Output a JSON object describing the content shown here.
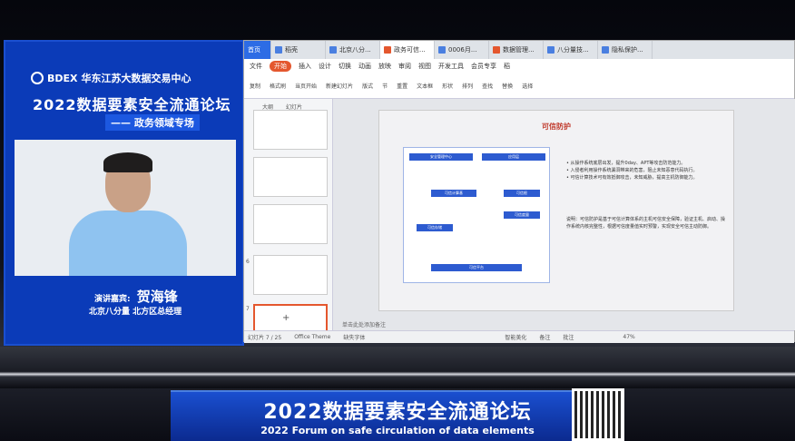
{
  "left_panel": {
    "logo_brand": "BDEX",
    "logo_org": "华东江苏大数据交易中心",
    "forum_title": "2022数据要素安全流通论坛",
    "sub_title": "—— 政务领域专场",
    "speaker_label": "演讲嘉宾:",
    "speaker_name": "贺海锋",
    "speaker_title": "北京八分量 北方区总经理"
  },
  "tabs": [
    {
      "label": "首页"
    },
    {
      "label": "稻壳"
    },
    {
      "label": "北京八分..."
    },
    {
      "label": "政务可信..."
    },
    {
      "label": "0006月..."
    },
    {
      "label": "数据管理..."
    },
    {
      "label": "八分量技..."
    },
    {
      "label": "隐私保护..."
    }
  ],
  "menu": [
    "文件",
    "开始",
    "插入",
    "设计",
    "切换",
    "动画",
    "放映",
    "审阅",
    "视图",
    "开发工具",
    "会员专享",
    "稻"
  ],
  "toolbar": [
    "复制",
    "格式刷",
    "当页开始",
    "新建幻灯片",
    "版式",
    "节",
    "重置",
    "文本框",
    "形状",
    "排列",
    "查找",
    "替换",
    "选择"
  ],
  "sidebar": {
    "tab_outline": "大纲",
    "tab_slides": "幻灯片",
    "numbers": [
      "",
      "",
      "",
      "6",
      "7"
    ],
    "add": "+"
  },
  "slide": {
    "title": "可信防护",
    "bullets": [
      "• 从操作系统底层出发，提升0day、APT等攻击防范能力。",
      "• 入侵者利用操作系统漏洞带来的危害，阻止未知恶意代码执行。",
      "• 可信计算技术可有效抵御攻击，未知威胁，提高主机防御能力。"
    ],
    "note": "说明：可信防护是基于可信计算体系的主机可信安全保障，验证主机、启动、操作系统内核完整性，根据可信度量值实时预警，实现安全可信主动防御。",
    "diagram_labels": [
      "安全管理中心",
      "应用层",
      "可信计算基",
      "可信根",
      "可信存储",
      "可信度量",
      "可信平台"
    ]
  },
  "notes_placeholder": "单击此处添加备注",
  "status": {
    "page": "幻灯片 7 / 25",
    "theme": "Office Theme",
    "font_warn": "缺失字体",
    "smart": "智能美化",
    "notes": "备注",
    "comment": "批注",
    "zoom": "47%"
  },
  "banner": {
    "cn": "2022数据要素安全流通论坛",
    "en": "2022 Forum on safe circulation of data elements"
  }
}
